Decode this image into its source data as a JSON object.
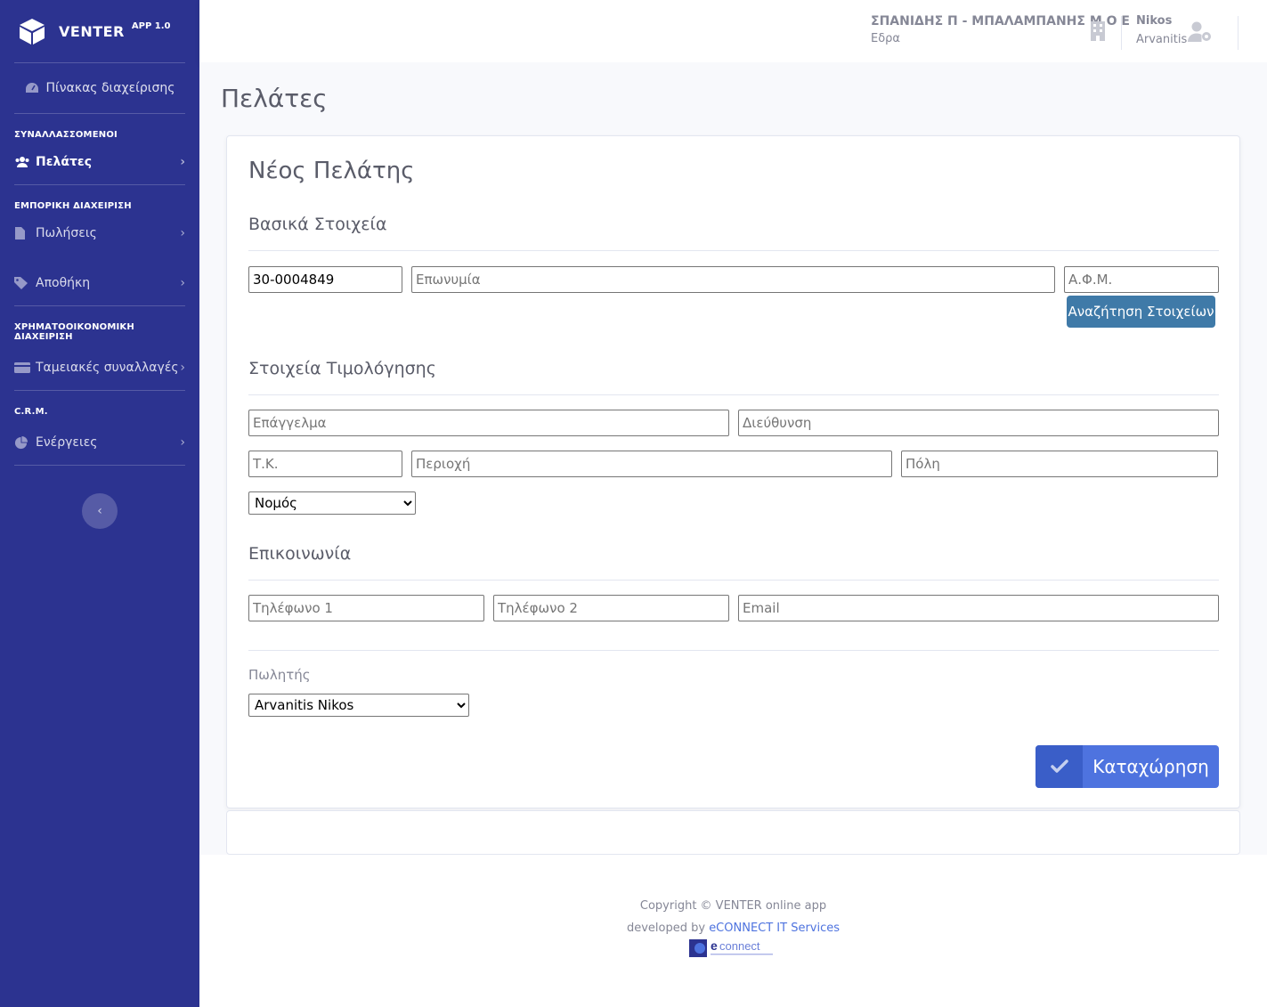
{
  "brand": {
    "name": "VENTER",
    "version": "APP 1.0"
  },
  "sidebar": {
    "dashboard": "Πίνακας διαχείρισης",
    "sections": [
      {
        "title": "ΣΥΝΑΛΛΑΣΣΟΜΕΝΟΙ",
        "items": [
          {
            "label": "Πελάτες",
            "icon": "users-icon",
            "active": true
          }
        ]
      },
      {
        "title": "ΕΜΠΟΡΙΚΗ ΔΙΑΧΕΙΡΙΣΗ",
        "items": [
          {
            "label": "Πωλήσεις",
            "icon": "file-icon"
          },
          {
            "label": "Αποθήκη",
            "icon": "tag-icon"
          }
        ]
      },
      {
        "title": "ΧΡΗΜΑΤΟΟΙΚΟΝΟΜΙΚΗ ΔΙΑΧΕΙΡΙΣΗ",
        "items": [
          {
            "label": "Ταμειακές συναλλαγές",
            "icon": "credit-card-icon"
          }
        ]
      },
      {
        "title": "C.R.M.",
        "items": [
          {
            "label": "Ενέργειες",
            "icon": "pie-chart-icon"
          }
        ]
      }
    ]
  },
  "topbar": {
    "company_name": "ΣΠΑΝΙΔΗΣ Π - ΜΠΑΛΑΜΠΑΝΗΣ Μ Ο Ε",
    "company_branch": "Εδρα",
    "user_first": "Nikos",
    "user_last": "Arvanitis"
  },
  "page": {
    "title": "Πελάτες"
  },
  "form": {
    "title": "Νέος Πελάτης",
    "basic_title": "Βασικά Στοιχεία",
    "code_value": "30-0004849",
    "name_placeholder": "Επωνυμία",
    "afm_placeholder": "Α.Φ.Μ.",
    "search_button": "Αναζήτηση Στοιχείων",
    "billing_title": "Στοιχεία Τιμολόγησης",
    "profession_placeholder": "Επάγγελμα",
    "address_placeholder": "Διεύθυνση",
    "postal_placeholder": "Τ.Κ.",
    "area_placeholder": "Περιοχή",
    "city_placeholder": "Πόλη",
    "prefecture_selected": "Νομός",
    "contact_title": "Επικοινωνία",
    "phone1_placeholder": "Τηλέφωνο 1",
    "phone2_placeholder": "Τηλέφωνο 2",
    "email_placeholder": "Email",
    "seller_label": "Πωλητής",
    "seller_selected": "Arvanitis Nikos",
    "save_button": "Καταχώρηση"
  },
  "footer": {
    "copyright": "Copyright © VENTER online app",
    "developed_by": "developed by",
    "developer_link": "eCONNECT IT Services"
  },
  "colors": {
    "sidebar": "#2c3390",
    "primary": "#4e73df",
    "search_button": "#3f7aa8"
  }
}
